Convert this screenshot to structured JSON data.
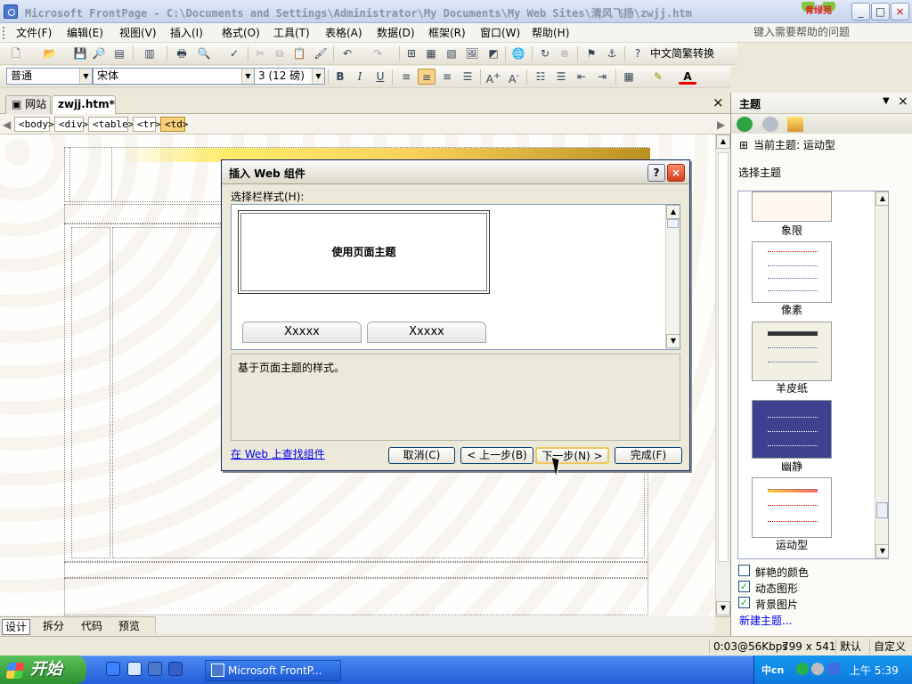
{
  "window": {
    "title": "Microsoft FrontPage - C:\\Documents and Settings\\Administrator\\My Documents\\My Web Sites\\清风飞扬\\zwjj.htm",
    "logo_text": "青绿苑"
  },
  "menu": {
    "items": [
      "文件(F)",
      "编辑(E)",
      "视图(V)",
      "插入(I)",
      "格式(O)",
      "工具(T)",
      "表格(A)",
      "数据(D)",
      "框架(R)",
      "窗口(W)",
      "帮助(H)"
    ],
    "help_placeholder": "键入需要帮助的问题"
  },
  "toolbar1": {
    "convert_label": "中文简繁转换"
  },
  "toolbar2": {
    "style_value": "普通",
    "font_value": "宋体",
    "size_value": "3 (12 磅)",
    "bold": "B",
    "italic": "I",
    "underline": "U",
    "color_letter": "A"
  },
  "doc_tabs": {
    "website": "网站",
    "file": "zwjj.htm*"
  },
  "tag_path": [
    "<body>",
    "<div>",
    "<table>",
    "<tr>",
    "<td>"
  ],
  "view_tabs": [
    "设计",
    "拆分",
    "代码",
    "预览"
  ],
  "status": {
    "speed": "0:03@56Kbps",
    "size": "799 x 541",
    "mode": "默认",
    "custom": "自定义"
  },
  "panel": {
    "title": "主题",
    "current_theme_label": "当前主题: 运动型",
    "choose_label": "选择主题",
    "themes": [
      "象限",
      "像素",
      "羊皮纸",
      "幽静",
      "运动型"
    ],
    "options": [
      {
        "label": "鲜艳的颜色",
        "checked": false
      },
      {
        "label": "动态图形",
        "checked": true
      },
      {
        "label": "背景图片",
        "checked": true
      }
    ],
    "new_theme": "新建主题..."
  },
  "dialog": {
    "title": "插入 Web 组件",
    "list_label": "选择栏样式(H):",
    "selected_style": "使用页面主题",
    "tab_a": "Xxxxx",
    "tab_b": "Xxxxx",
    "description": "基于页面主题的样式。",
    "find_link": "在 Web 上查找组件",
    "buttons": {
      "cancel": "取消(C)",
      "back": "< 上一步(B)",
      "next": "下一步(N) >",
      "finish": "完成(F)"
    }
  },
  "taskbar": {
    "start": "开始",
    "task": "Microsoft FrontP...",
    "clock": "上午 5:39",
    "tray_text": "中cn"
  },
  "colors": {
    "dialog_border": "#0a246a",
    "xp_blue": "#245ed9",
    "start_green": "#2d8f2f",
    "link_blue": "#0000ee"
  }
}
